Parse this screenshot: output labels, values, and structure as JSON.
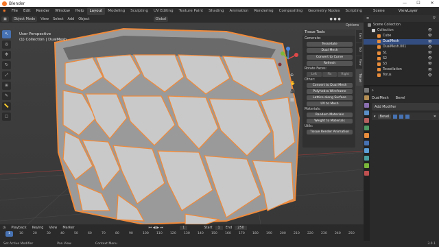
{
  "app": {
    "title": "Blender"
  },
  "window_controls": {
    "minimize": "—",
    "maximize": "☐",
    "close": "✕"
  },
  "menu": [
    "File",
    "Edit",
    "Render",
    "Window",
    "Help"
  ],
  "workspaces": [
    "Layout",
    "Modeling",
    "Sculpting",
    "UV Editing",
    "Texture Paint",
    "Shading",
    "Animation",
    "Rendering",
    "Compositing",
    "Geometry Nodes",
    "Scripting"
  ],
  "scene": {
    "name": "Scene",
    "view_layer": "ViewLayer"
  },
  "viewport_header": {
    "mode": "Object Mode",
    "view": "View",
    "select": "Select",
    "add": "Add",
    "object": "Object",
    "orientation": "Global",
    "options": "Options"
  },
  "viewport_overlay": {
    "line1": "User Perspective",
    "line2": "(1) Collection | DualMesh"
  },
  "tissue_tools": {
    "title": "Tissue Tools",
    "generate_label": "Generate:",
    "tessellate": "Tessellate",
    "dual_mesh": "Dual Mesh",
    "convert_to_curve": "Convert to Curve",
    "refresh": "Refresh",
    "rotate_faces_label": "Rotate Faces:",
    "rotate_left": "Left",
    "rotate_fix": "Fix",
    "rotate_right": "Right",
    "other_label": "Other:",
    "convert_to_dual_mesh": "Convert to Dual Mesh",
    "polyhedra_wireframe": "Polyhedra Wireframe",
    "lattice_along_surface": "Lattice along Surface",
    "uv_to_mesh": "UV to Mesh",
    "materials_label": "Materials:",
    "random_materials": "Random Materials",
    "weight_to_materials": "Weight to Materials",
    "utils_label": "Utils:",
    "tissue_render_animation": "Tissue Render Animation"
  },
  "sidebar_tabs": [
    "Item",
    "Tool",
    "View",
    "Tissue"
  ],
  "outliner": {
    "header": "Scene Collection",
    "items": [
      {
        "label": "Collection",
        "color": "#cfcfcf",
        "selected": false
      },
      {
        "label": "Cube",
        "color": "#e88d3b",
        "selected": false
      },
      {
        "label": "DualMesh",
        "color": "#e88d3b",
        "selected": true
      },
      {
        "label": "DualMesh.001",
        "color": "#e88d3b",
        "selected": false
      },
      {
        "label": "S1",
        "color": "#e88d3b",
        "selected": false
      },
      {
        "label": "S2",
        "color": "#e88d3b",
        "selected": false
      },
      {
        "label": "S3",
        "color": "#e88d3b",
        "selected": false
      },
      {
        "label": "Tessellation",
        "color": "#e88d3b",
        "selected": false
      },
      {
        "label": "Torus",
        "color": "#e88d3b",
        "selected": false
      }
    ]
  },
  "properties": {
    "object_name": "DualMesh",
    "modifier_type": "Bevel",
    "add_modifier": "Add Modifier",
    "modifier_name": "Bevel"
  },
  "timeline": {
    "playback": "Playback",
    "keying": "Keying",
    "view": "View",
    "marker": "Marker",
    "current_frame": "1",
    "start_label": "Start",
    "start": "1",
    "end_label": "End",
    "end": "250",
    "ticks": [
      "10",
      "20",
      "30",
      "40",
      "50",
      "60",
      "70",
      "80",
      "90",
      "100",
      "110",
      "120",
      "130",
      "140",
      "150",
      "160",
      "170",
      "180",
      "190",
      "200",
      "210",
      "220",
      "230",
      "240",
      "250"
    ]
  },
  "status": {
    "left": "Set Active Modifier",
    "mid": "Pan View",
    "right": "Context Menu",
    "version": "3.0.1"
  },
  "colors": {
    "accent": "#4772b3",
    "outline": "#f08a3a",
    "selected_row": "#334d80"
  }
}
